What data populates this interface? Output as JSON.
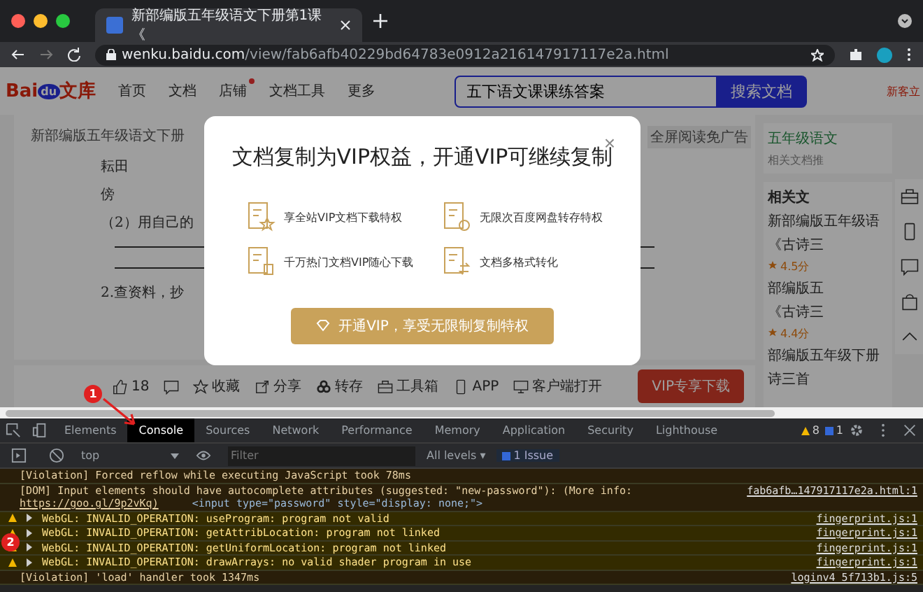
{
  "browser": {
    "tab_title": "新部编版五年级语文下册第1课《",
    "url_host": "wenku.baidu.com",
    "url_path": "/view/fab6afb40229bd64783e0912a216147917117e2a.html"
  },
  "site": {
    "logo_text": "Bai",
    "logo_paw": "du",
    "logo_suffix": "文库",
    "nav": [
      {
        "label": "首页",
        "dot": false
      },
      {
        "label": "文档",
        "dot": false
      },
      {
        "label": "店铺",
        "dot": true
      },
      {
        "label": "文档工具",
        "dot": false
      },
      {
        "label": "更多",
        "dot": false
      }
    ],
    "search": {
      "value": "五下语文课课练答案",
      "button": "搜索文档"
    },
    "new_user": "新客立"
  },
  "document": {
    "breadcrumb": "新部编版五年级语文下册",
    "ad_tag": "全屏阅读免广告",
    "lines": [
      {
        "kind": "text",
        "text": "耘田"
      },
      {
        "kind": "text",
        "text": "傍"
      },
      {
        "kind": "text",
        "text": "（2）用自己的"
      },
      {
        "kind": "rule"
      },
      {
        "kind": "rule"
      },
      {
        "kind": "text",
        "text": "2.查资料，抄"
      }
    ]
  },
  "toolbar": {
    "likes": "18",
    "actions": [
      {
        "label": "收藏",
        "kind": "star"
      },
      {
        "label": "分享",
        "kind": "share"
      },
      {
        "label": "转存",
        "kind": "save"
      },
      {
        "label": "工具箱",
        "kind": "toolbox"
      },
      {
        "label": "APP",
        "kind": "app"
      },
      {
        "label": "客户端打开",
        "kind": "desktop"
      }
    ],
    "download": "VIP专享下载"
  },
  "sidebar": {
    "promo_title": "五年级语文",
    "promo_sub": "相关文档推",
    "related_title": "相关文",
    "items": [
      {
        "title": "新部编版五年级语",
        "sub": "《古诗三",
        "rating": "4.5分"
      },
      {
        "title": "部编版五",
        "sub": "《古诗三",
        "rating": "4.4分"
      },
      {
        "title": "部编版五年级下册",
        "sub": "诗三首"
      }
    ]
  },
  "modal": {
    "title": "文档复制为VIP权益，开通VIP可继续复制",
    "benefits": [
      {
        "label": "享全站VIP文档下载特权",
        "kind": "star"
      },
      {
        "label": "无限次百度网盘转存特权",
        "kind": "cycle"
      },
      {
        "label": "千万热门文档VIP随心下载",
        "kind": "free"
      },
      {
        "label": "文档多格式转化",
        "kind": "convert"
      }
    ],
    "button": "开通VIP，享受无限制复制特权",
    "close": "×"
  },
  "devtools": {
    "tabs": [
      {
        "label": "Elements",
        "selected": false
      },
      {
        "label": "Console",
        "selected": true
      },
      {
        "label": "Sources",
        "selected": false
      },
      {
        "label": "Network",
        "selected": false
      },
      {
        "label": "Performance",
        "selected": false
      },
      {
        "label": "Memory",
        "selected": false
      },
      {
        "label": "Application",
        "selected": false
      },
      {
        "label": "Security",
        "selected": false
      },
      {
        "label": "Lighthouse",
        "selected": false
      }
    ],
    "warnings": "8",
    "infos": "1",
    "context": "top",
    "filter_placeholder": "Filter",
    "levels": "All levels ▾",
    "issues": "1 Issue",
    "messages": [
      {
        "kind": "violation",
        "text": "[Violation] Forced reflow while executing JavaScript took 78ms"
      },
      {
        "kind": "dom",
        "text": "[DOM] Input elements should have autocomplete attributes (suggested: \"new-password\"): (More info:",
        "link": "https://goo.gl/9p2vKq)",
        "code": "<input type=\"password\" style=\"display: none;\">",
        "source": "fab6afb…147917117e2a.html:1"
      },
      {
        "kind": "warning",
        "text": "WebGL: INVALID_OPERATION: useProgram: program not valid",
        "source": "fingerprint.js:1"
      },
      {
        "kind": "warning",
        "text": "WebGL: INVALID_OPERATION: getAttribLocation: program not linked",
        "source": "fingerprint.js:1"
      },
      {
        "kind": "warning",
        "text": "WebGL: INVALID_OPERATION: getUniformLocation: program not linked",
        "source": "fingerprint.js:1"
      },
      {
        "kind": "warning",
        "text": "WebGL: INVALID_OPERATION: drawArrays: no valid shader program in use",
        "source": "fingerprint.js:1"
      },
      {
        "kind": "violation",
        "text": "[Violation] 'load' handler took 1347ms",
        "source": "loginv4_5f713b1.js:5"
      }
    ]
  },
  "annotations": [
    "1",
    "2"
  ]
}
